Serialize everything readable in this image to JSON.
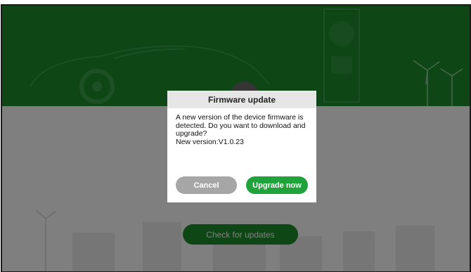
{
  "dialog": {
    "title": "Firmware update",
    "message": "A new version of the device firmware is detected. Do you want to download and upgrade?",
    "version_text": "New version:V1.0.23",
    "cancel_label": "Cancel",
    "upgrade_label": "Upgrade now"
  },
  "main": {
    "check_label": "Check for updates"
  },
  "colors": {
    "brand_green": "#1d8c2b",
    "button_green": "#1fa33a",
    "cancel_gray": "#a6a6a6",
    "title_bar": "#e6e6e6"
  },
  "icons": [
    "car-illustration",
    "charger-illustration",
    "wind-turbine-illustration",
    "building-illustration"
  ]
}
